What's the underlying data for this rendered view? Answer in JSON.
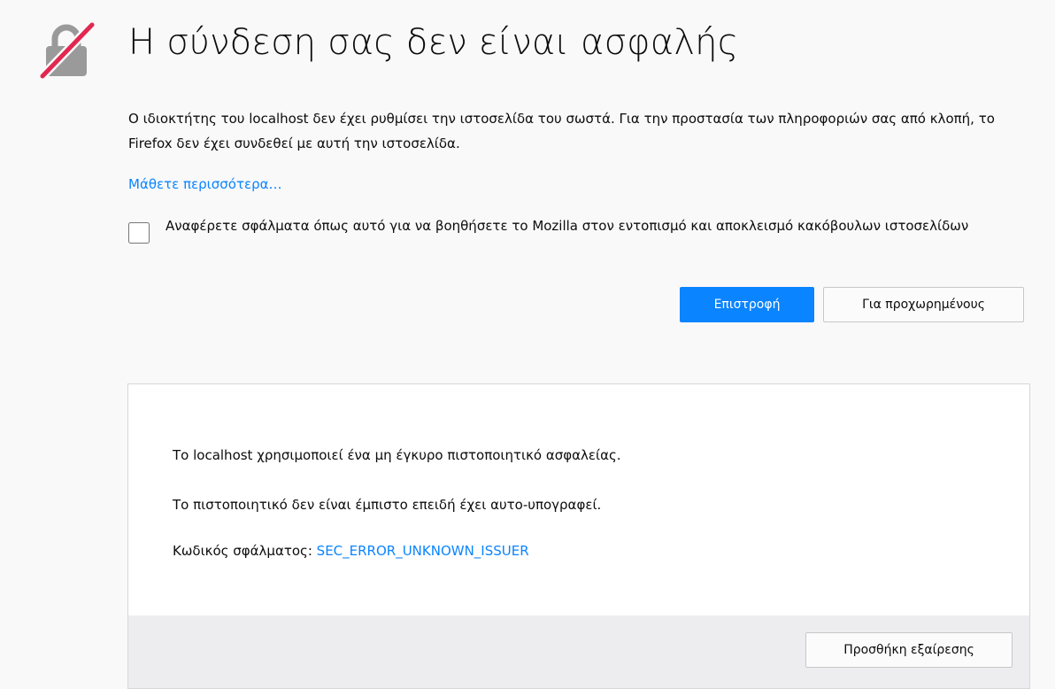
{
  "page": {
    "title": "Η σύνδεση σας δεν είναι ασφαλής",
    "icon": "broken-lock-icon",
    "description": "Ο ιδιοκτήτης του localhost δεν έχει ρυθμίσει την ιστοσελίδα του σωστά. Για την προστασία των πληροφοριών σας από κλοπή, το Firefox δεν έχει συνδεθεί με αυτή την ιστοσελίδα.",
    "learn_more": "Μάθετε περισσότερα…",
    "report_checkbox": {
      "label": "Αναφέρετε σφάλματα όπως αυτό για να βοηθήσετε το Mozilla στον εντοπισμό και αποκλεισμό κακόβουλων ιστοσελίδων",
      "checked": false
    },
    "buttons": {
      "go_back": "Επιστροφή",
      "advanced": "Για προχωρημένους"
    }
  },
  "advanced": {
    "line1": "Το localhost χρησιμοποιεί ένα μη έγκυρο πιστοποιητικό ασφαλείας.",
    "line2": "Το πιστοποιητικό δεν είναι έμπιστο επειδή έχει αυτο-υπογραφεί.",
    "error_code_label": "Κωδικός σφάλματος: ",
    "error_code": "SEC_ERROR_UNKNOWN_ISSUER",
    "add_exception": "Προσθήκη εξαίρεσης"
  },
  "colors": {
    "accent": "#0a84ff",
    "background": "#f9f9fa",
    "icon_gray": "#9a9a9a",
    "icon_red": "#e22850"
  }
}
